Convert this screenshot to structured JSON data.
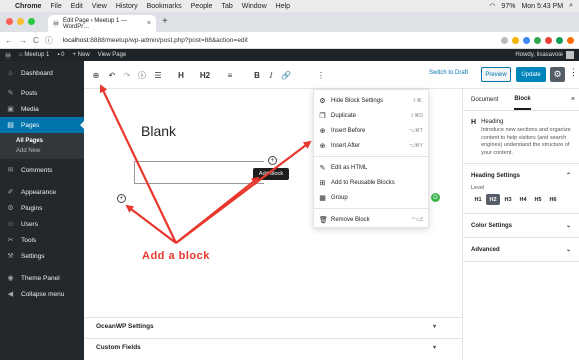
{
  "mac": {
    "menus": [
      "Chrome",
      "File",
      "Edit",
      "View",
      "History",
      "Bookmarks",
      "People",
      "Tab",
      "Window",
      "Help"
    ],
    "battery": "97%",
    "clock": "Mon 5:43 PM"
  },
  "browser": {
    "tab_title": "Edit Page ‹ Meetup 1 — WordPr…",
    "url_host": "localhost",
    "url_rest": ":8888/meetup/wp-admin/post.php?post=88&action=edit"
  },
  "wpbar": {
    "site": "Meetup 1",
    "comments": "0",
    "new": "New",
    "view": "View Page",
    "greeting": "Howdy, lisasavoie"
  },
  "sidebar": {
    "items": [
      {
        "icon": "⌂",
        "label": "Dashboard"
      },
      {
        "icon": "✎",
        "label": "Posts"
      },
      {
        "icon": "▣",
        "label": "Media"
      },
      {
        "icon": "▤",
        "label": "Pages"
      }
    ],
    "sub": [
      "All Pages",
      "Add New"
    ],
    "items2": [
      {
        "icon": "✉",
        "label": "Comments"
      },
      {
        "icon": "✐",
        "label": "Appearance"
      },
      {
        "icon": "⚙",
        "label": "Plugins"
      },
      {
        "icon": "☺",
        "label": "Users"
      },
      {
        "icon": "✂",
        "label": "Tools"
      },
      {
        "icon": "⚒",
        "label": "Settings"
      },
      {
        "icon": "◉",
        "label": "Theme Panel"
      },
      {
        "icon": "◀",
        "label": "Collapse menu"
      }
    ]
  },
  "editor": {
    "tools": [
      "⊕",
      "↶",
      "↷",
      "ⓘ",
      "☰",
      "H",
      "H2",
      "≡",
      "B",
      "I",
      "🔗",
      "⋮"
    ],
    "save_draft": "Switch to Draft",
    "preview": "Preview",
    "update": "Update",
    "title": "Blank",
    "tooltip": "Add block",
    "annotation": "Add a block"
  },
  "block_menu": {
    "items": [
      {
        "icon": "⚙",
        "label": "Hide Block Settings",
        "shortcut": "⇧⌘,"
      },
      {
        "icon": "❐",
        "label": "Duplicate",
        "shortcut": "⇧⌘D"
      },
      {
        "icon": "⊕",
        "label": "Insert Before",
        "shortcut": "⌥⌘T"
      },
      {
        "icon": "⊕",
        "label": "Insert After",
        "shortcut": "⌥⌘Y"
      },
      {
        "icon": "✎",
        "label": "Edit as HTML",
        "shortcut": ""
      },
      {
        "icon": "⊞",
        "label": "Add to Reusable Blocks",
        "shortcut": ""
      },
      {
        "icon": "▦",
        "label": "Group",
        "shortcut": ""
      },
      {
        "icon": "🗑",
        "label": "Remove Block",
        "shortcut": "^⌥Z"
      }
    ]
  },
  "metaboxes": [
    "OceanWP Settings",
    "Custom Fields"
  ],
  "panel": {
    "tab_document": "Document",
    "tab_block": "Block",
    "block_name": "Heading",
    "block_desc": "Introduce new sections and organize content to help visitors (and search engines) understand the structure of your content.",
    "heading_settings": "Heading Settings",
    "level_label": "Level",
    "levels": [
      "H1",
      "H2",
      "H3",
      "H4",
      "H5",
      "H6"
    ],
    "selected_level": "H2",
    "color_settings": "Color Settings",
    "advanced": "Advanced"
  },
  "colors": {
    "accent": "#0073aa",
    "annotation": "#e8382d",
    "admin_bg": "#23282d"
  }
}
